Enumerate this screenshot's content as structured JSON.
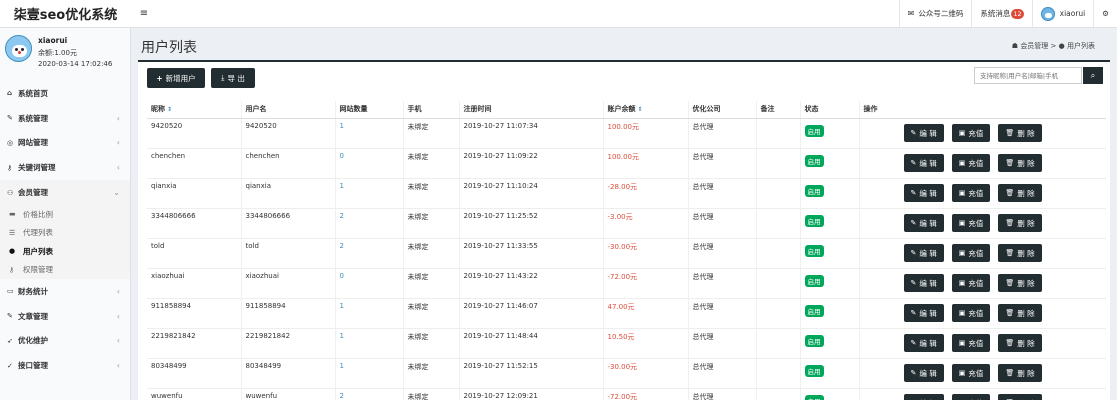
{
  "app": {
    "logo": "柒壹seo优化系统"
  },
  "topbar": {
    "menu_icon": "menu-icon",
    "wechat_label": "公众号二维码",
    "notice_label": "系统消息",
    "notice_count": "12",
    "user_label": "xiaorui"
  },
  "sidebar": {
    "user": {
      "name": "xiaorui",
      "balance": "余额:1.00元",
      "time": "2020-03-14 17:02:46"
    },
    "nav": [
      {
        "label": "系统首页",
        "icon": "home-icon",
        "has_arrow": false
      },
      {
        "label": "系统管理",
        "icon": "wrench-icon",
        "has_arrow": true
      },
      {
        "label": "网站管理",
        "icon": "globe-icon",
        "has_arrow": true
      },
      {
        "label": "关键词管理",
        "icon": "key-icon",
        "has_arrow": true
      },
      {
        "label": "会员管理",
        "icon": "users-icon",
        "has_arrow": true,
        "open": true
      },
      {
        "label": "财务统计",
        "icon": "money-icon",
        "has_arrow": true
      },
      {
        "label": "文章管理",
        "icon": "edit-icon",
        "has_arrow": true
      },
      {
        "label": "优化维护",
        "icon": "rocket-icon",
        "has_arrow": true
      },
      {
        "label": "接口管理",
        "icon": "plug-icon",
        "has_arrow": true
      }
    ],
    "sub": [
      {
        "label": "价格比例",
        "icon": "money-icon"
      },
      {
        "label": "代理列表",
        "icon": "list-icon"
      },
      {
        "label": "用户列表",
        "icon": "user-icon",
        "active": true
      },
      {
        "label": "权限管理",
        "icon": "key-icon"
      }
    ]
  },
  "page": {
    "title": "用户列表",
    "breadcrumb_root": "会员管理",
    "breadcrumb_sep": ">",
    "breadcrumb_current": "用户列表"
  },
  "toolbar": {
    "add_label": "新增用户",
    "export_label": "导 出",
    "search_placeholder": "支持昵称|用户名|邮箱|手机"
  },
  "table": {
    "columns": [
      "昵称",
      "用户名",
      "网站数量",
      "手机",
      "注册时间",
      "账户余额",
      "优化公司",
      "备注",
      "状态",
      "操作"
    ],
    "rows": [
      {
        "nick": "9420520",
        "username": "9420520",
        "sites": "1",
        "phone": "未绑定",
        "reg": "2019-10-27 11:07:34",
        "balance": "100.00元",
        "company": "总代理",
        "note": "",
        "status": "启用"
      },
      {
        "nick": "chenchen",
        "username": "chenchen",
        "sites": "0",
        "phone": "未绑定",
        "reg": "2019-10-27 11:09:22",
        "balance": "100.00元",
        "company": "总代理",
        "note": "",
        "status": "启用"
      },
      {
        "nick": "qianxia",
        "username": "qianxia",
        "sites": "1",
        "phone": "未绑定",
        "reg": "2019-10-27 11:10:24",
        "balance": "-28.00元",
        "company": "总代理",
        "note": "",
        "status": "启用"
      },
      {
        "nick": "3344806666",
        "username": "3344806666",
        "sites": "2",
        "phone": "未绑定",
        "reg": "2019-10-27 11:25:52",
        "balance": "-3.00元",
        "company": "总代理",
        "note": "",
        "status": "启用"
      },
      {
        "nick": "told",
        "username": "told",
        "sites": "2",
        "phone": "未绑定",
        "reg": "2019-10-27 11:33:55",
        "balance": "-30.00元",
        "company": "总代理",
        "note": "",
        "status": "启用"
      },
      {
        "nick": "xiaozhuai",
        "username": "xiaozhuai",
        "sites": "0",
        "phone": "未绑定",
        "reg": "2019-10-27 11:43:22",
        "balance": "-72.00元",
        "company": "总代理",
        "note": "",
        "status": "启用"
      },
      {
        "nick": "911858894",
        "username": "911858894",
        "sites": "1",
        "phone": "未绑定",
        "reg": "2019-10-27 11:46:07",
        "balance": "47.00元",
        "company": "总代理",
        "note": "",
        "status": "启用"
      },
      {
        "nick": "2219821842",
        "username": "2219821842",
        "sites": "1",
        "phone": "未绑定",
        "reg": "2019-10-27 11:48:44",
        "balance": "10.50元",
        "company": "总代理",
        "note": "",
        "status": "启用"
      },
      {
        "nick": "80348499",
        "username": "80348499",
        "sites": "1",
        "phone": "未绑定",
        "reg": "2019-10-27 11:52:15",
        "balance": "-30.00元",
        "company": "总代理",
        "note": "",
        "status": "启用"
      },
      {
        "nick": "wuwenfu",
        "username": "wuwenfu",
        "sites": "2",
        "phone": "未绑定",
        "reg": "2019-10-27 12:09:21",
        "balance": "-72.00元",
        "company": "总代理",
        "note": "",
        "status": "启用"
      }
    ],
    "actions": {
      "edit": "编 辑",
      "recharge": "充值",
      "delete": "删 除"
    }
  }
}
